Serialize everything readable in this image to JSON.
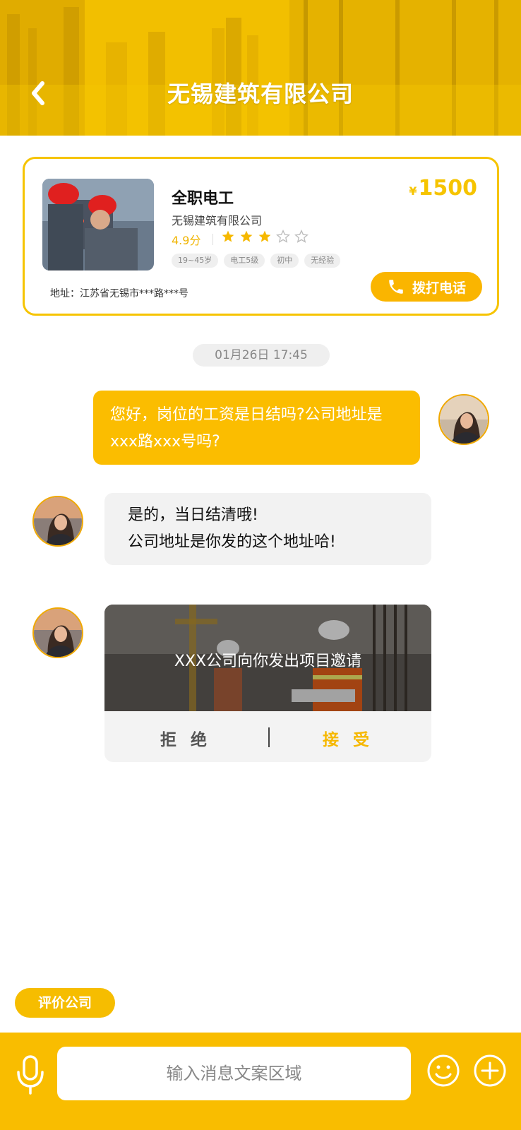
{
  "header": {
    "title": "无锡建筑有限公司",
    "back_icon": "chevron-left-icon"
  },
  "job_card": {
    "job_title": "全职电工",
    "company": "无锡建筑有限公司",
    "rating": "4.9分",
    "stars_filled": 3,
    "stars_total": 5,
    "tags": [
      "19~45岁",
      "电工5级",
      "初中",
      "无经验"
    ],
    "currency": "¥",
    "price": "1500",
    "address": "地址：江苏省无锡市***路***号",
    "call_label": "拨打电话",
    "call_icon": "phone-icon"
  },
  "chat": {
    "timestamp": "01月26日 17:45",
    "messages": [
      {
        "direction": "outgoing",
        "text": "您好，岗位的工资是日结吗?公司地址是xxx路xxx号吗?"
      },
      {
        "direction": "incoming",
        "lines": [
          "是的，当日结清哦!",
          "公司地址是你发的这个地址哈!"
        ]
      }
    ],
    "invite": {
      "text": "XXX公司向你发出项目邀请",
      "reject_label": "拒 绝",
      "accept_label": "接 受"
    }
  },
  "rate_button": {
    "label": "评价公司"
  },
  "input_bar": {
    "placeholder": "输入消息文案区域",
    "mic_icon": "microphone-icon",
    "emoji_icon": "smiley-icon",
    "plus_icon": "plus-circle-icon"
  },
  "colors": {
    "accent": "#f6c400",
    "call_button": "#fab500",
    "outgoing_bubble": "#fbbd00",
    "incoming_bubble": "#f2f2f2",
    "accept": "#f6b800"
  }
}
